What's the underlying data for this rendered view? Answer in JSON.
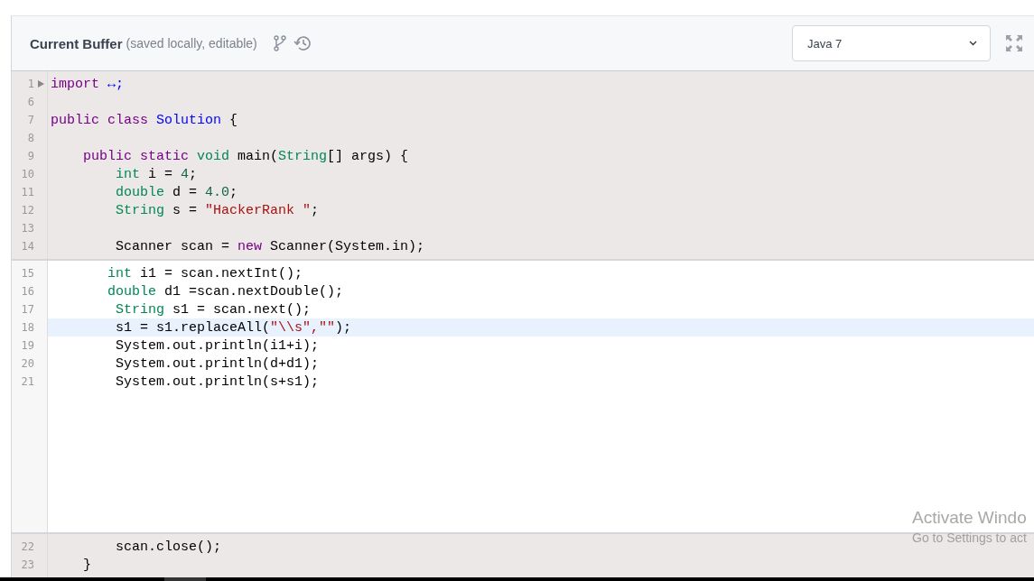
{
  "header": {
    "title": "Current Buffer",
    "subtitle": "(saved locally, editable)",
    "language": "Java 7"
  },
  "sections": [
    {
      "kind": "readonly",
      "lines": [
        {
          "number": "1",
          "fold": true,
          "highlighted": false,
          "tokens": [
            {
              "text": "import",
              "color": "#770088"
            },
            {
              "text": " ↔;",
              "color": "#0000ff"
            }
          ]
        },
        {
          "number": "6",
          "fold": false,
          "highlighted": false
        },
        {
          "number": "7",
          "fold": false,
          "highlighted": false,
          "tokens": [
            {
              "text": "public class",
              "color": "#770088"
            },
            {
              "text": " Solution",
              "color": "#0000ff"
            },
            {
              "text": " {",
              "color": "#000000"
            }
          ]
        },
        {
          "number": "8",
          "fold": false,
          "highlighted": false
        },
        {
          "number": "9",
          "fold": false,
          "highlighted": false,
          "tokens": [
            {
              "text": "    public static",
              "color": "#770088"
            },
            {
              "text": " void",
              "color": "#008855"
            },
            {
              "text": " main(",
              "color": "#000000"
            },
            {
              "text": "String",
              "color": "#008855"
            },
            {
              "text": "[] args) {",
              "color": "#000000"
            }
          ]
        },
        {
          "number": "10",
          "fold": false,
          "highlighted": false,
          "tokens": [
            {
              "text": "        int",
              "color": "#008855"
            },
            {
              "text": " i =",
              "color": "#000000"
            },
            {
              "text": " 4",
              "color": "#116644"
            },
            {
              "text": ";",
              "color": "#000000"
            }
          ]
        },
        {
          "number": "11",
          "fold": false,
          "highlighted": false,
          "tokens": [
            {
              "text": "        double",
              "color": "#008855"
            },
            {
              "text": " d =",
              "color": "#000000"
            },
            {
              "text": " 4.0",
              "color": "#116644"
            },
            {
              "text": ";",
              "color": "#000000"
            }
          ]
        },
        {
          "number": "12",
          "fold": false,
          "highlighted": false,
          "tokens": [
            {
              "text": "        String",
              "color": "#008855"
            },
            {
              "text": " s =",
              "color": "#000000"
            },
            {
              "text": " \"HackerRank \"",
              "color": "#aa1111"
            },
            {
              "text": ";",
              "color": "#000000"
            }
          ]
        },
        {
          "number": "13",
          "fold": false,
          "highlighted": false
        },
        {
          "number": "14",
          "fold": false,
          "highlighted": false,
          "tokens": [
            {
              "text": "        Scanner scan =",
              "color": "#000000"
            },
            {
              "text": " new",
              "color": "#770088"
            },
            {
              "text": " Scanner(System.in);",
              "color": "#000000"
            }
          ]
        }
      ]
    },
    {
      "kind": "editable",
      "lines": [
        {
          "number": "15",
          "fold": false,
          "highlighted": false,
          "tokens": [
            {
              "text": "       int",
              "color": "#008855"
            },
            {
              "text": " i1 = scan.nextInt();",
              "color": "#000000"
            }
          ]
        },
        {
          "number": "16",
          "fold": false,
          "highlighted": false,
          "tokens": [
            {
              "text": "       double",
              "color": "#008855"
            },
            {
              "text": " d1 =scan.nextDouble();",
              "color": "#000000"
            }
          ]
        },
        {
          "number": "17",
          "fold": false,
          "highlighted": false,
          "tokens": [
            {
              "text": "        String",
              "color": "#008855"
            },
            {
              "text": " s1 = scan.next();",
              "color": "#000000"
            }
          ]
        },
        {
          "number": "18",
          "fold": false,
          "highlighted": true,
          "tokens": [
            {
              "text": "        s1 = s1.replaceAll(",
              "color": "#000000"
            },
            {
              "text": "\"\\\\s\",\"\"",
              "color": "#aa1111"
            },
            {
              "text": ");",
              "color": "#000000"
            }
          ]
        },
        {
          "number": "19",
          "fold": false,
          "highlighted": false,
          "tokens": [
            {
              "text": "        System.out.println(i1+i);",
              "color": "#000000"
            }
          ]
        },
        {
          "number": "20",
          "fold": false,
          "highlighted": false,
          "tokens": [
            {
              "text": "        System.out.println(d+d1);",
              "color": "#000000"
            }
          ]
        },
        {
          "number": "21",
          "fold": false,
          "highlighted": false,
          "tokens": [
            {
              "text": "        System.out.println(s+s1);",
              "color": "#000000"
            }
          ]
        }
      ]
    },
    {
      "kind": "readonly",
      "lines": [
        {
          "number": "22",
          "fold": false,
          "highlighted": false,
          "tokens": [
            {
              "text": "        scan.close();",
              "color": "#000000"
            }
          ]
        },
        {
          "number": "23",
          "fold": false,
          "highlighted": false,
          "tokens": [
            {
              "text": "    }",
              "color": "#000000"
            }
          ]
        }
      ]
    }
  ],
  "os_overlay": {
    "title": "Activate Windo",
    "subtitle": "Go to Settings to act"
  }
}
